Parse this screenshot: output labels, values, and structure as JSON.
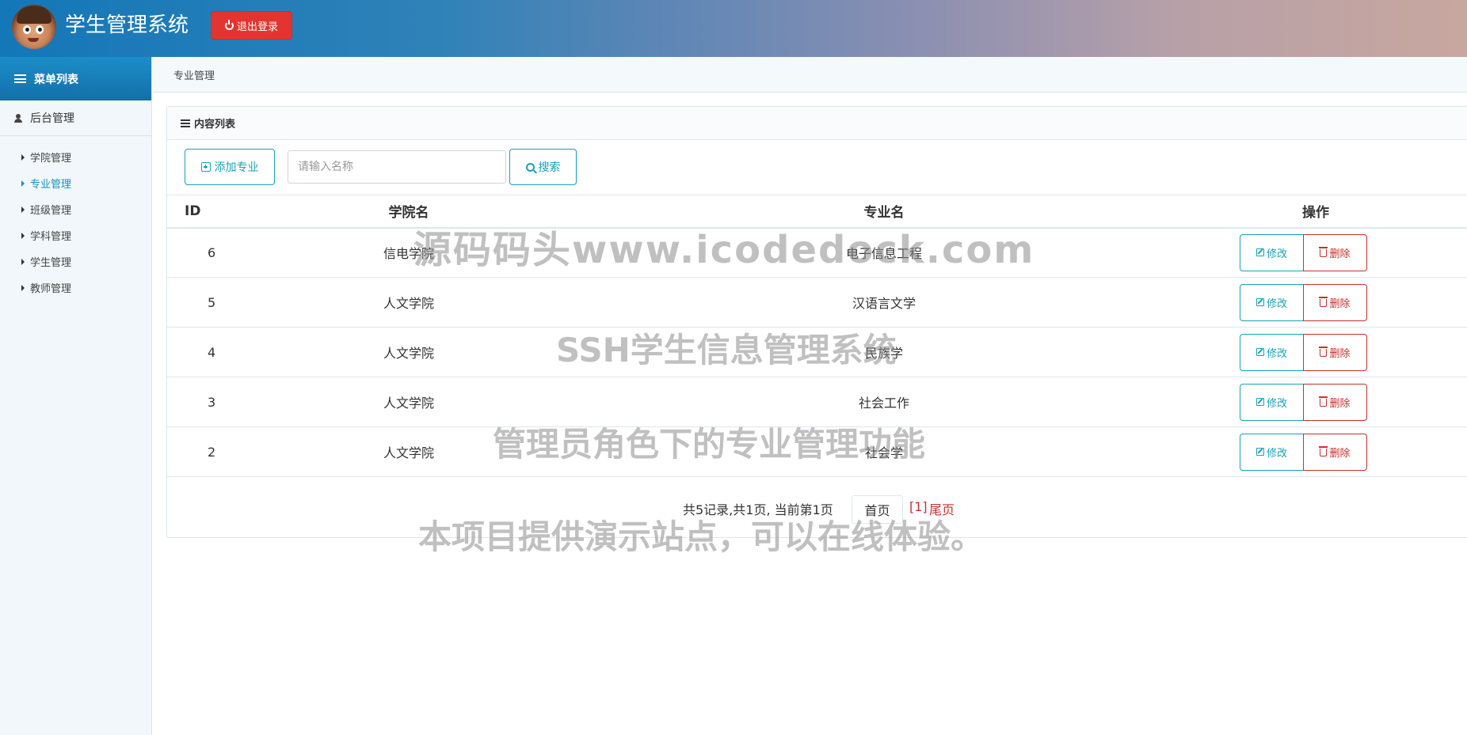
{
  "header": {
    "app_title": "学生管理系统",
    "logout_label": "退出登录",
    "avatar_icon": "cartoon-boy-avatar",
    "accent_color": "#e3342f"
  },
  "sidebar": {
    "menu_title": "菜单列表",
    "group_title": "后台管理",
    "items": [
      {
        "label": "学院管理",
        "active": false
      },
      {
        "label": "专业管理",
        "active": true
      },
      {
        "label": "班级管理",
        "active": false
      },
      {
        "label": "学科管理",
        "active": false
      },
      {
        "label": "学生管理",
        "active": false
      },
      {
        "label": "教师管理",
        "active": false
      }
    ]
  },
  "breadcrumb": "专业管理",
  "panel": {
    "title": "内容列表",
    "add_button": "添加专业",
    "search_placeholder": "请输入名称",
    "search_value": "",
    "search_button": "搜索"
  },
  "table": {
    "columns": [
      "ID",
      "学院名",
      "专业名",
      "操作"
    ],
    "edit_label": "修改",
    "delete_label": "删除",
    "rows": [
      {
        "id": "6",
        "college": "信电学院",
        "major": "电子信息工程"
      },
      {
        "id": "5",
        "college": "人文学院",
        "major": "汉语言文学"
      },
      {
        "id": "4",
        "college": "人文学院",
        "major": "民族学"
      },
      {
        "id": "3",
        "college": "人文学院",
        "major": "社会工作"
      },
      {
        "id": "2",
        "college": "人文学院",
        "major": "社会学"
      }
    ]
  },
  "pager": {
    "info": "共5记录,共1页, 当前第1页",
    "first": "首页",
    "current": "[1]",
    "last": "尾页"
  },
  "watermarks": [
    "源码码头www.icodedock.com",
    "SSH学生信息管理系统",
    "管理员角色下的专业管理功能",
    "本项目提供演示站点，可以在线体验。"
  ]
}
